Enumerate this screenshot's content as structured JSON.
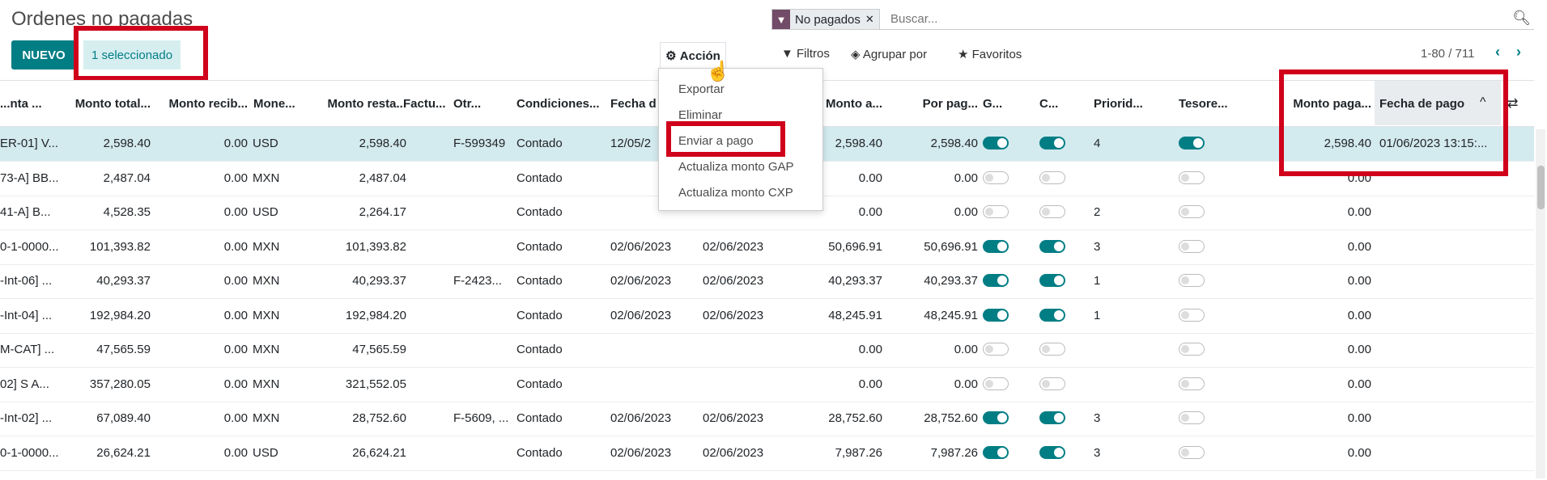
{
  "page": {
    "title": "Ordenes no pagadas"
  },
  "buttons": {
    "new": "NUEVO",
    "selected": "1 seleccionado"
  },
  "action_menu": {
    "label": "Acción",
    "items": [
      "Exportar",
      "Eliminar",
      "Enviar a pago",
      "Actualiza monto GAP",
      "Actualiza monto CXP"
    ]
  },
  "search": {
    "facet_label": "No pagados",
    "placeholder": "Buscar..."
  },
  "toolbar": {
    "filters": "Filtros",
    "group_by": "Agrupar por",
    "favorites": "Favoritos"
  },
  "pager": {
    "text": "1-80 / 711"
  },
  "columns": [
    "...nta ...",
    "Monto total...",
    "Monto recib...",
    "Mone...",
    "Monto resta...",
    "Factu...",
    "Otr...",
    "Condiciones...",
    "Fecha d",
    "Monto a...",
    "Por pag...",
    "G...",
    "C...",
    "Priorid...",
    "Tesore...",
    "Monto paga...",
    "Fecha de pago"
  ],
  "rows": [
    {
      "c0": "ER-01] V...",
      "c1": "2,598.40",
      "c2": "0.00",
      "c3": "USD",
      "c4": "2,598.40",
      "c5": "",
      "c6": "F-599349",
      "c7": "Contado",
      "c8": "12/05/2",
      "c9": "",
      "c10": "2,598.40",
      "c11": "2,598.40",
      "g": true,
      "c": true,
      "p": "4",
      "t": true,
      "m": "2,598.40",
      "f": "01/06/2023 13:15:..."
    },
    {
      "c0": "73-A] BB...",
      "c1": "2,487.04",
      "c2": "0.00",
      "c3": "MXN",
      "c4": "2,487.04",
      "c5": "",
      "c6": "",
      "c7": "Contado",
      "c8": "",
      "c9": "",
      "c10": "0.00",
      "c11": "0.00",
      "g": false,
      "c": false,
      "p": "",
      "t": false,
      "m": "0.00",
      "f": ""
    },
    {
      "c0": "41-A] B...",
      "c1": "4,528.35",
      "c2": "0.00",
      "c3": "USD",
      "c4": "2,264.17",
      "c5": "",
      "c6": "",
      "c7": "Contado",
      "c8": "",
      "c9": "",
      "c10": "0.00",
      "c11": "0.00",
      "g": false,
      "c": false,
      "p": "2",
      "t": false,
      "m": "0.00",
      "f": ""
    },
    {
      "c0": "0-1-0000...",
      "c1": "101,393.82",
      "c2": "0.00",
      "c3": "MXN",
      "c4": "101,393.82",
      "c5": "",
      "c6": "",
      "c7": "Contado",
      "c8": "02/06/2023",
      "c9": "02/06/2023",
      "c10": "50,696.91",
      "c11": "50,696.91",
      "g": true,
      "c": true,
      "p": "3",
      "t": false,
      "m": "0.00",
      "f": ""
    },
    {
      "c0": "-Int-06] ...",
      "c1": "40,293.37",
      "c2": "0.00",
      "c3": "MXN",
      "c4": "40,293.37",
      "c5": "",
      "c6": "F-2423...",
      "c7": "Contado",
      "c8": "02/06/2023",
      "c9": "02/06/2023",
      "c10": "40,293.37",
      "c11": "40,293.37",
      "g": true,
      "c": true,
      "p": "1",
      "t": false,
      "m": "0.00",
      "f": ""
    },
    {
      "c0": "-Int-04] ...",
      "c1": "192,984.20",
      "c2": "0.00",
      "c3": "MXN",
      "c4": "192,984.20",
      "c5": "",
      "c6": "",
      "c7": "Contado",
      "c8": "02/06/2023",
      "c9": "02/06/2023",
      "c10": "48,245.91",
      "c11": "48,245.91",
      "g": true,
      "c": true,
      "p": "1",
      "t": false,
      "m": "0.00",
      "f": ""
    },
    {
      "c0": "M-CAT] ...",
      "c1": "47,565.59",
      "c2": "0.00",
      "c3": "MXN",
      "c4": "47,565.59",
      "c5": "",
      "c6": "",
      "c7": "Contado",
      "c8": "",
      "c9": "",
      "c10": "0.00",
      "c11": "0.00",
      "g": false,
      "c": false,
      "p": "",
      "t": false,
      "m": "0.00",
      "f": ""
    },
    {
      "c0": "02] S A...",
      "c1": "357,280.05",
      "c2": "0.00",
      "c3": "MXN",
      "c4": "321,552.05",
      "c5": "",
      "c6": "",
      "c7": "Contado",
      "c8": "",
      "c9": "",
      "c10": "0.00",
      "c11": "0.00",
      "g": false,
      "c": false,
      "p": "",
      "t": false,
      "m": "0.00",
      "f": ""
    },
    {
      "c0": "-Int-02] ...",
      "c1": "67,089.40",
      "c2": "0.00",
      "c3": "MXN",
      "c4": "28,752.60",
      "c5": "",
      "c6": "F-5609, ...",
      "c7": "Contado",
      "c8": "02/06/2023",
      "c9": "02/06/2023",
      "c10": "28,752.60",
      "c11": "28,752.60",
      "g": true,
      "c": true,
      "p": "3",
      "t": false,
      "m": "0.00",
      "f": ""
    },
    {
      "c0": "0-1-0000...",
      "c1": "26,624.21",
      "c2": "0.00",
      "c3": "USD",
      "c4": "26,624.21",
      "c5": "",
      "c6": "",
      "c7": "Contado",
      "c8": "02/06/2023",
      "c9": "02/06/2023",
      "c10": "7,987.26",
      "c11": "7,987.26",
      "g": true,
      "c": true,
      "p": "3",
      "t": false,
      "m": "0.00",
      "f": ""
    }
  ]
}
